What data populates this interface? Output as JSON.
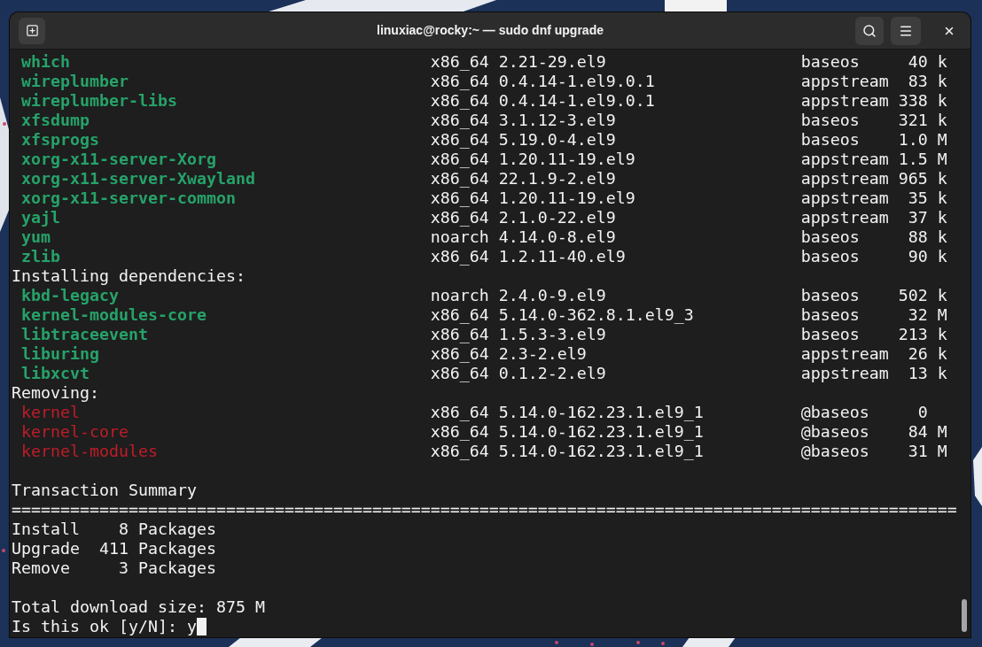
{
  "window": {
    "title": "linuxiac@rocky:~ — sudo dnf upgrade"
  },
  "terminal": {
    "groups": [
      {
        "color": "#26a269",
        "bold": true,
        "packages": [
          {
            "name": "which",
            "arch": "x86_64",
            "version": "2.21-29.el9",
            "repo": "baseos",
            "size": "40",
            "unit": "k"
          },
          {
            "name": "wireplumber",
            "arch": "x86_64",
            "version": "0.4.14-1.el9.0.1",
            "repo": "appstream",
            "size": "83",
            "unit": "k"
          },
          {
            "name": "wireplumber-libs",
            "arch": "x86_64",
            "version": "0.4.14-1.el9.0.1",
            "repo": "appstream",
            "size": "338",
            "unit": "k"
          },
          {
            "name": "xfsdump",
            "arch": "x86_64",
            "version": "3.1.12-3.el9",
            "repo": "baseos",
            "size": "321",
            "unit": "k"
          },
          {
            "name": "xfsprogs",
            "arch": "x86_64",
            "version": "5.19.0-4.el9",
            "repo": "baseos",
            "size": "1.0",
            "unit": "M"
          },
          {
            "name": "xorg-x11-server-Xorg",
            "arch": "x86_64",
            "version": "1.20.11-19.el9",
            "repo": "appstream",
            "size": "1.5",
            "unit": "M"
          },
          {
            "name": "xorg-x11-server-Xwayland",
            "arch": "x86_64",
            "version": "22.1.9-2.el9",
            "repo": "appstream",
            "size": "965",
            "unit": "k"
          },
          {
            "name": "xorg-x11-server-common",
            "arch": "x86_64",
            "version": "1.20.11-19.el9",
            "repo": "appstream",
            "size": "35",
            "unit": "k"
          },
          {
            "name": "yajl",
            "arch": "x86_64",
            "version": "2.1.0-22.el9",
            "repo": "appstream",
            "size": "37",
            "unit": "k"
          },
          {
            "name": "yum",
            "arch": "noarch",
            "version": "4.14.0-8.el9",
            "repo": "baseos",
            "size": "88",
            "unit": "k"
          },
          {
            "name": "zlib",
            "arch": "x86_64",
            "version": "1.2.11-40.el9",
            "repo": "baseos",
            "size": "90",
            "unit": "k"
          }
        ]
      },
      {
        "heading": "Installing dependencies:",
        "color": "#26a269",
        "bold": true,
        "packages": [
          {
            "name": "kbd-legacy",
            "arch": "noarch",
            "version": "2.4.0-9.el9",
            "repo": "baseos",
            "size": "502",
            "unit": "k"
          },
          {
            "name": "kernel-modules-core",
            "arch": "x86_64",
            "version": "5.14.0-362.8.1.el9_3",
            "repo": "baseos",
            "size": "32",
            "unit": "M"
          },
          {
            "name": "libtraceevent",
            "arch": "x86_64",
            "version": "1.5.3-3.el9",
            "repo": "baseos",
            "size": "213",
            "unit": "k"
          },
          {
            "name": "liburing",
            "arch": "x86_64",
            "version": "2.3-2.el9",
            "repo": "appstream",
            "size": "26",
            "unit": "k"
          },
          {
            "name": "libxcvt",
            "arch": "x86_64",
            "version": "0.1.2-2.el9",
            "repo": "appstream",
            "size": "13",
            "unit": "k"
          }
        ]
      },
      {
        "heading": "Removing:",
        "color": "#c01c28",
        "bold": false,
        "packages": [
          {
            "name": "kernel",
            "arch": "x86_64",
            "version": "5.14.0-162.23.1.el9_1",
            "repo": "@baseos",
            "size": "0"
          },
          {
            "name": "kernel-core",
            "arch": "x86_64",
            "version": "5.14.0-162.23.1.el9_1",
            "repo": "@baseos",
            "size": "84",
            "unit": "M"
          },
          {
            "name": "kernel-modules",
            "arch": "x86_64",
            "version": "5.14.0-162.23.1.el9_1",
            "repo": "@baseos",
            "size": "31",
            "unit": "M"
          }
        ]
      }
    ],
    "summary_title": "Transaction Summary",
    "rule": "=================================================================================================",
    "summary": [
      {
        "action": "Install",
        "count": "8",
        "unit": "Packages"
      },
      {
        "action": "Upgrade",
        "count": "411",
        "unit": "Packages"
      },
      {
        "action": "Remove",
        "count": "3",
        "unit": "Packages"
      }
    ],
    "total": "Total download size: 875 M",
    "prompt": "Is this ok [y/N]:",
    "answer": "y",
    "cursor": true
  }
}
